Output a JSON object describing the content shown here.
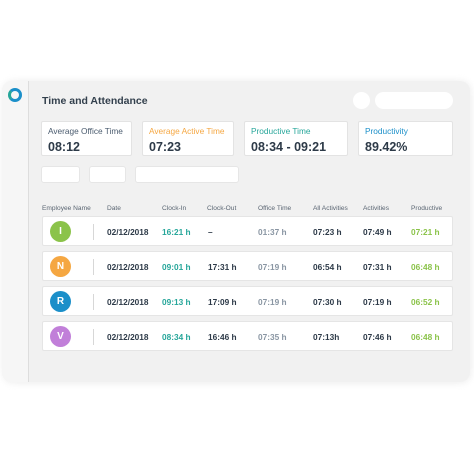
{
  "app": {
    "title": "Time and Attendance",
    "colors": {
      "accent": "#1b8fc9",
      "green": "#26a69a",
      "orange": "#f5a742",
      "muted": "#8a96a3",
      "lime": "#8bc34a"
    }
  },
  "stats": [
    {
      "label": "Average Office Time",
      "value": "08:12",
      "color": "#4a5b6e"
    },
    {
      "label": "Average Active Time",
      "value": "07:23",
      "color": "#f5a742"
    },
    {
      "label": "Productive Time",
      "value": "08:34 - 09:21",
      "color": "#26a69a"
    },
    {
      "label": "Productivity",
      "value": "89.42%",
      "color": "#1b8fc9"
    }
  ],
  "table": {
    "columns": [
      "Employee Name",
      "Date",
      "Clock-In",
      "Clock-Out",
      "Office Time",
      "All Activities",
      "Activities",
      "Productive"
    ],
    "rows": [
      {
        "initial": "I",
        "avatar_color": "#8bc34a",
        "date": "02/12/2018",
        "clock_in": "16:21 h",
        "clock_out": "–",
        "office_time": "01:37 h",
        "all_activities": "07:23 h",
        "activities": "07:49 h",
        "productive": "07:21 h"
      },
      {
        "initial": "N",
        "avatar_color": "#f5a742",
        "date": "02/12/2018",
        "clock_in": "09:01 h",
        "clock_out": "17:31 h",
        "office_time": "07:19 h",
        "all_activities": "06:54 h",
        "activities": "07:31 h",
        "productive": "06:48 h"
      },
      {
        "initial": "R",
        "avatar_color": "#1b8fc9",
        "date": "02/12/2018",
        "clock_in": "09:13 h",
        "clock_out": "17:09 h",
        "office_time": "07:19 h",
        "all_activities": "07:30 h",
        "activities": "07:19 h",
        "productive": "06:52 h"
      },
      {
        "initial": "V",
        "avatar_color": "#c17fd9",
        "date": "02/12/2018",
        "clock_in": "08:34 h",
        "clock_out": "16:46 h",
        "office_time": "07:35 h",
        "all_activities": "07:13h",
        "activities": "07:46 h",
        "productive": "06:48 h"
      }
    ]
  }
}
